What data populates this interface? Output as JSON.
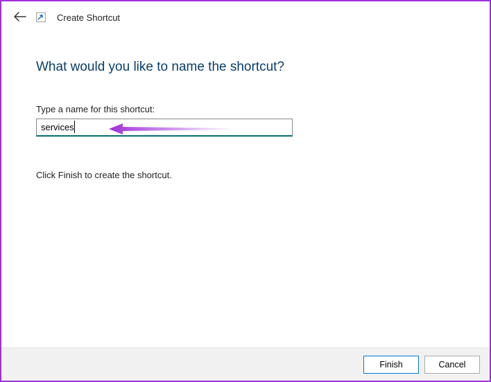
{
  "header": {
    "wizard_title": "Create Shortcut"
  },
  "content": {
    "heading": "What would you like to name the shortcut?",
    "field_label": "Type a name for this shortcut:",
    "input_value": "services",
    "instruction": "Click Finish to create the shortcut."
  },
  "footer": {
    "finish_label": "Finish",
    "cancel_label": "Cancel"
  },
  "colors": {
    "accent_border": "#a030d8",
    "heading_color": "#0a3e6b",
    "input_underline": "#0a6e6e",
    "arrow_fill": "#a030d8"
  }
}
